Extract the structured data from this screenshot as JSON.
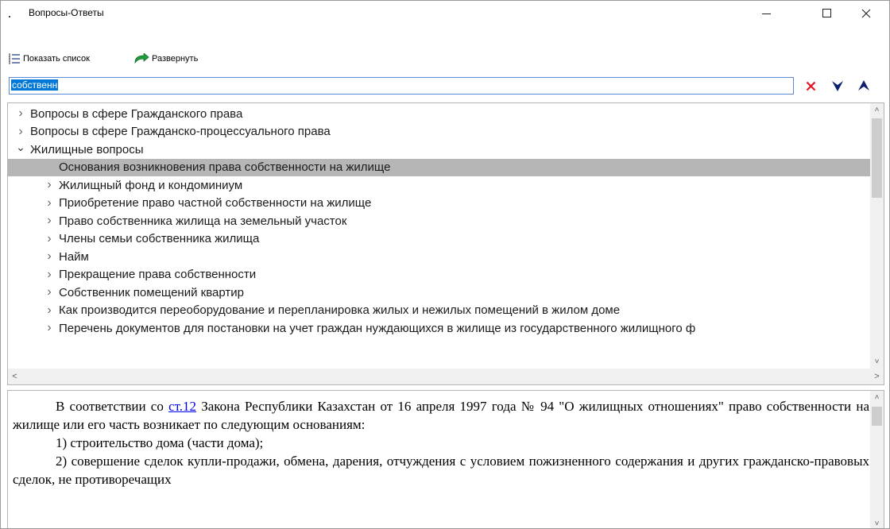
{
  "window": {
    "title": "Вопросы-Ответы"
  },
  "toolbar": {
    "show_list_label": "Показать список",
    "expand_label": "Развернуть"
  },
  "search": {
    "value": "собственн"
  },
  "tree": {
    "items": [
      {
        "label": "Вопросы в сфере Гражданского права",
        "level": 0,
        "expander": "collapsed"
      },
      {
        "label": "Вопросы в сфере Гражданско-процессуального права",
        "level": 0,
        "expander": "collapsed"
      },
      {
        "label": "Жилищные вопросы",
        "level": 0,
        "expander": "expanded"
      },
      {
        "label": "Основания возникновения права собственности на жилище",
        "level": 1,
        "expander": "none",
        "selected": true
      },
      {
        "label": "Жилищный фонд и кондоминиум",
        "level": 1,
        "expander": "collapsed"
      },
      {
        "label": "Приобретение право частной собственности на жилище",
        "level": 1,
        "expander": "collapsed"
      },
      {
        "label": "Право собственника жилища на земельный участок",
        "level": 1,
        "expander": "collapsed"
      },
      {
        "label": "Члены семьи собственника жилища",
        "level": 1,
        "expander": "collapsed"
      },
      {
        "label": "Найм",
        "level": 1,
        "expander": "collapsed"
      },
      {
        "label": "Прекращение права собственности",
        "level": 1,
        "expander": "collapsed"
      },
      {
        "label": "Собственник помещений квартир",
        "level": 1,
        "expander": "collapsed"
      },
      {
        "label": "Как производится переоборудование и перепланировка жилых и нежилых помещений в жилом доме",
        "level": 1,
        "expander": "collapsed"
      },
      {
        "label": "Перечень документов для постановки на учет граждан нуждающихся в жилище из государственного жилищного ф",
        "level": 1,
        "expander": "collapsed"
      }
    ]
  },
  "content": {
    "p1_pre": "В соответствии со ",
    "p1_link": "ст.12",
    "p1_post": " Закона Республики Казахстан от 16 апреля 1997 года № 94 \"О жилищных отношениях\" право собственности на жилище или его часть возникает по следующим основаниям:",
    "p2": "1) строительство дома (части дома);",
    "p3": "2) совершение сделок купли-продажи, обмена, дарения, отчуждения с условием пожизненного содержания и других гражданско-правовых сделок, не противоречащих"
  },
  "colors": {
    "selection": "#b6b6b6",
    "search_highlight": "#0078d7",
    "link": "#0000ee",
    "clear_icon": "#e81123",
    "arrow_icon": "#0a1f6e",
    "expand_icon": "#1e9e3a"
  }
}
